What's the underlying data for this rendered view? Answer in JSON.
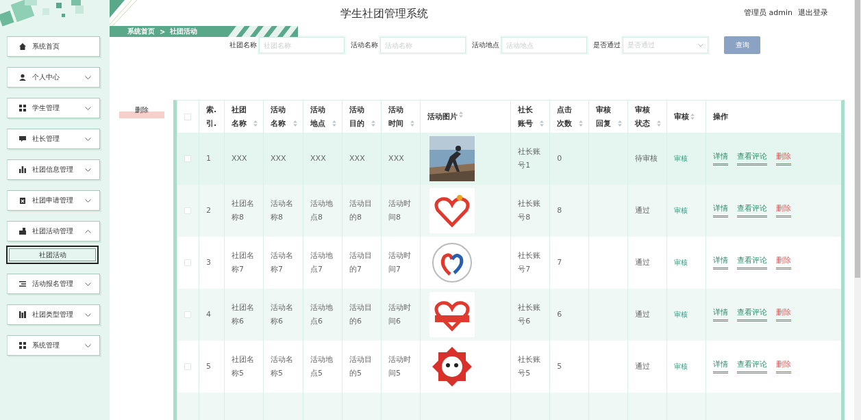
{
  "header": {
    "title": "学生社团管理系统",
    "user": "管理员 admin",
    "logout": "退出登录"
  },
  "sidebar": {
    "items": [
      {
        "label": "系统首页",
        "has_caret": false
      },
      {
        "label": "个人中心",
        "has_caret": true,
        "expanded": false
      },
      {
        "label": "学生管理",
        "has_caret": true,
        "expanded": false
      },
      {
        "label": "社长管理",
        "has_caret": true,
        "expanded": false
      },
      {
        "label": "社团信息管理",
        "has_caret": true,
        "expanded": false
      },
      {
        "label": "社团申请管理",
        "has_caret": true,
        "expanded": false
      },
      {
        "label": "社团活动管理",
        "has_caret": true,
        "expanded": true,
        "children": [
          {
            "label": "社团活动",
            "selected": true
          }
        ]
      },
      {
        "label": "活动报名管理",
        "has_caret": true,
        "expanded": false
      },
      {
        "label": "社团类型管理",
        "has_caret": true,
        "expanded": false
      },
      {
        "label": "系统管理",
        "has_caret": true,
        "expanded": false
      }
    ]
  },
  "breadcrumb": [
    "系统首页",
    ">",
    "社团活动"
  ],
  "search": {
    "fields": [
      {
        "kind": "input",
        "label": "社团名称",
        "placeholder": "社团名称"
      },
      {
        "kind": "input",
        "label": "活动名称",
        "placeholder": "活动名称"
      },
      {
        "kind": "input",
        "label": "活动地点",
        "placeholder": "活动地点"
      },
      {
        "kind": "select",
        "label": "是否通过",
        "placeholder": "是否通过"
      }
    ],
    "button": "查询"
  },
  "delete_button": "删除",
  "table": {
    "header_checked": false,
    "columns": [
      {
        "label": "索.引.",
        "sortable": false
      },
      {
        "label": "社团名称",
        "sortable": true
      },
      {
        "label": "活动名称",
        "sortable": true
      },
      {
        "label": "活动地点",
        "sortable": true
      },
      {
        "label": "活动目的",
        "sortable": true
      },
      {
        "label": "活动时间",
        "sortable": true
      },
      {
        "label": "活动图片",
        "sortable": true
      },
      {
        "label": "社长账号",
        "sortable": true
      },
      {
        "label": "点击次数",
        "sortable": true
      },
      {
        "label": "审核回复",
        "sortable": true
      },
      {
        "label": "审核状态",
        "sortable": true
      },
      {
        "label": "审核",
        "sortable": true
      },
      {
        "label": "操作",
        "sortable": false
      }
    ],
    "rows": [
      {
        "checked": false,
        "hovered": true,
        "cells": [
          "1",
          "XXX",
          "XXX",
          "XXX",
          "XXX",
          "XXX"
        ],
        "account": "社长账号1",
        "clicks": "0",
        "status": "待审核",
        "review": "审核",
        "actions": [
          "详情",
          "查看评论",
          "删除"
        ]
      },
      {
        "checked": false,
        "hovered": false,
        "cells": [
          "2",
          "社团名称8",
          "活动名称8",
          "活动地点8",
          "活动目的8",
          "活动时间8"
        ],
        "account": "社长账号8",
        "clicks": "8",
        "status": "通过",
        "review": "审核",
        "actions": [
          "详情",
          "查看评论",
          "删除"
        ]
      },
      {
        "checked": false,
        "hovered": false,
        "cells": [
          "3",
          "社团名称7",
          "活动名称7",
          "活动地点7",
          "活动目的7",
          "活动时间7"
        ],
        "account": "社长账号7",
        "clicks": "7",
        "status": "通过",
        "review": "审核",
        "actions": [
          "详情",
          "查看评论",
          "删除"
        ]
      },
      {
        "checked": false,
        "hovered": false,
        "cells": [
          "4",
          "社团名称6",
          "活动名称6",
          "活动地点6",
          "活动目的6",
          "活动时间6"
        ],
        "account": "社长账号6",
        "clicks": "6",
        "status": "通过",
        "review": "审核",
        "actions": [
          "详情",
          "查看评论",
          "删除"
        ]
      },
      {
        "checked": false,
        "hovered": false,
        "cells": [
          "5",
          "社团名称5",
          "活动名称5",
          "活动地点5",
          "活动目的5",
          "活动时间5"
        ],
        "account": "社长账号5",
        "clicks": "5",
        "status": "通过",
        "review": "审核",
        "actions": [
          "详情",
          "查看评论",
          "删除"
        ]
      }
    ]
  }
}
